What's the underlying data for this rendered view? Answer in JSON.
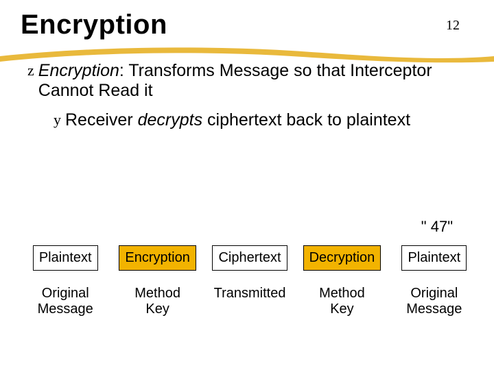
{
  "page_number": "12",
  "title": "Encryption",
  "bullet1": {
    "prefix": "z",
    "term": "Encryption",
    "rest": ": Transforms Message so that Interceptor Cannot Read it"
  },
  "bullet2": {
    "prefix": "y",
    "before": "Receiver ",
    "italic": "decrypts",
    "after": " ciphertext back to plaintext"
  },
  "annotation": "\" 47\"",
  "flow": {
    "row1": [
      {
        "label": "Plaintext",
        "style": "boxed"
      },
      {
        "label": "Encryption",
        "style": "hilite"
      },
      {
        "label": "Ciphertext",
        "style": "boxed"
      },
      {
        "label": "Decryption",
        "style": "hilite"
      },
      {
        "label": "Plaintext",
        "style": "boxed"
      }
    ],
    "row2": [
      "Original\nMessage",
      "Method\nKey",
      "Transmitted",
      "Method\nKey",
      "Original\nMessage"
    ]
  }
}
